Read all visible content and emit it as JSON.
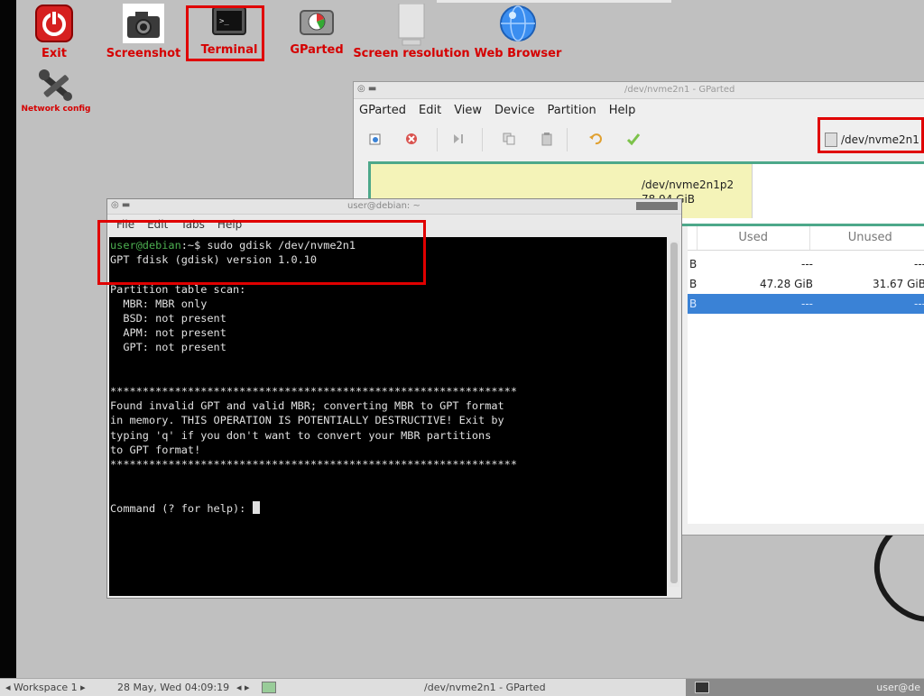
{
  "desktop": {
    "launchers": {
      "exit": "Exit",
      "screenshot": "Screenshot",
      "terminal": "Terminal",
      "gparted": "GParted",
      "resolution": "Screen resolution",
      "browser": "Web Browser",
      "network": "Network config"
    }
  },
  "gparted": {
    "title": "/dev/nvme2n1 - GParted",
    "menu": [
      "GParted",
      "Edit",
      "View",
      "Device",
      "Partition",
      "Help"
    ],
    "device_selector": "/dev/nvme2n1",
    "graph": {
      "partition_name": "/dev/nvme2n1p2",
      "partition_size": "78.94 GiB"
    },
    "table": {
      "headers": [
        "Used",
        "Unused"
      ],
      "rows": [
        {
          "prefix": "B",
          "used": "---",
          "unused": "---"
        },
        {
          "prefix": "B",
          "used": "47.28 GiB",
          "unused": "31.67 GiB"
        },
        {
          "prefix": "B",
          "used": "---",
          "unused": "---"
        }
      ]
    }
  },
  "terminal": {
    "title": "user@debian: ~",
    "menu": [
      "File",
      "Edit",
      "Tabs",
      "Help"
    ],
    "prompt_user": "user@debian",
    "prompt_rest": ":~$ sudo gdisk /dev/nvme2n1",
    "output": "GPT fdisk (gdisk) version 1.0.10\n\nPartition table scan:\n  MBR: MBR only\n  BSD: not present\n  APM: not present\n  GPT: not present\n\n\n***************************************************************\nFound invalid GPT and valid MBR; converting MBR to GPT format\nin memory. THIS OPERATION IS POTENTIALLY DESTRUCTIVE! Exit by\ntyping 'q' if you don't want to convert your MBR partitions\nto GPT format!\n***************************************************************\n\n\nCommand (? for help): "
  },
  "taskbar": {
    "workspace": "◂ Workspace 1 ▸",
    "clock": "28 May, Wed 04:09:19",
    "task_gparted": "/dev/nvme2n1 - GParted",
    "task_terminal": "user@de"
  }
}
